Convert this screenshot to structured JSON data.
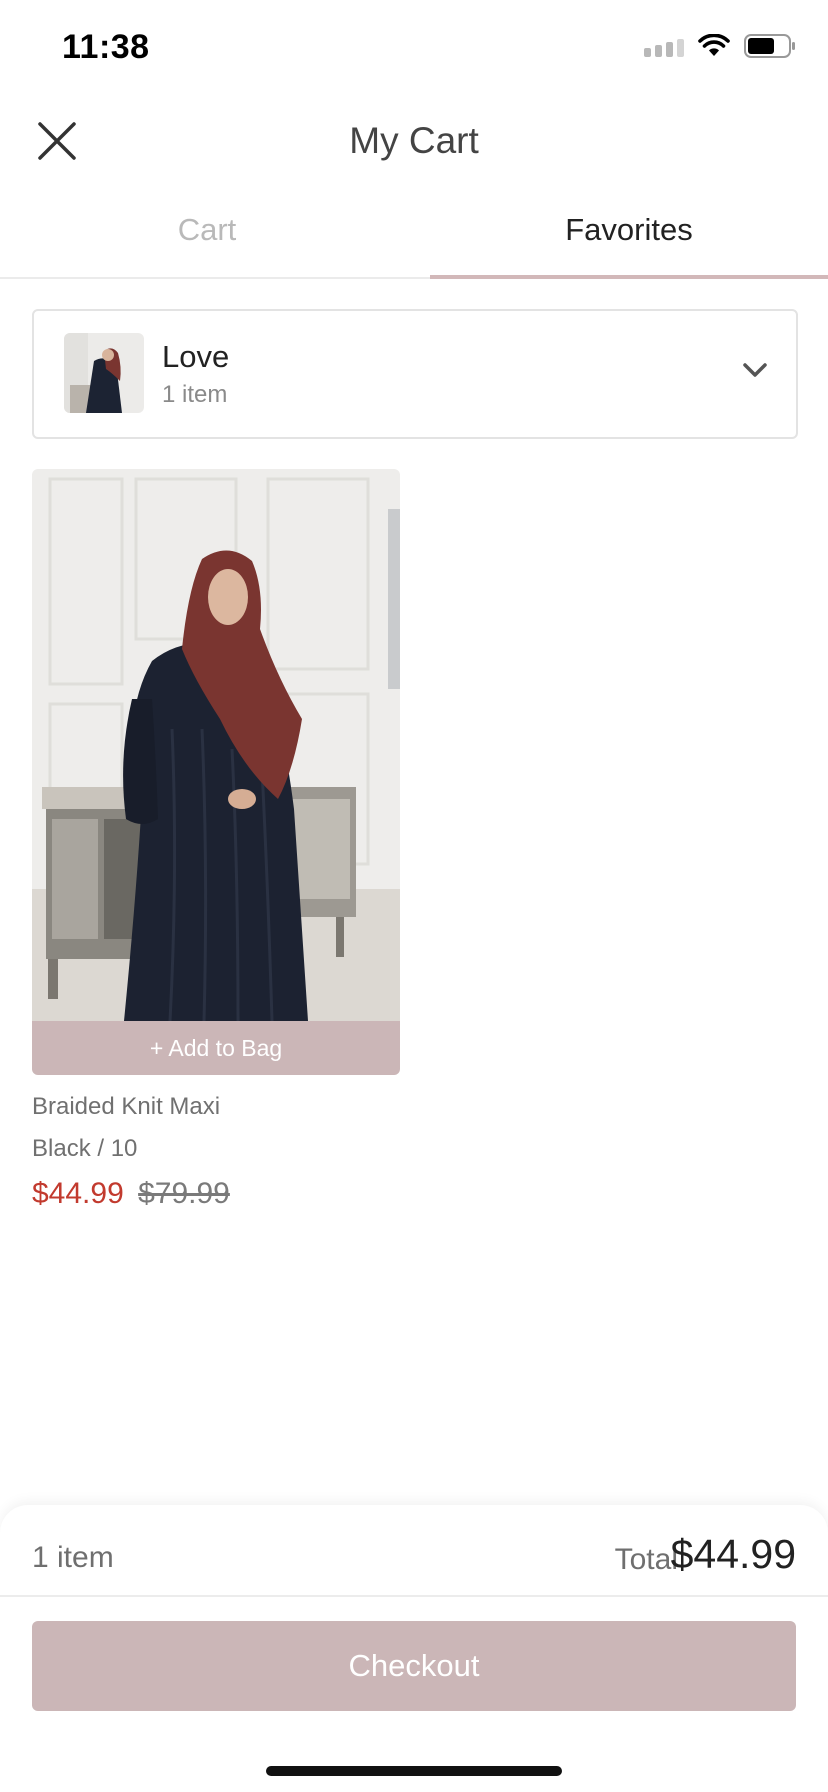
{
  "status_bar": {
    "time": "11:38",
    "icons": [
      "cellular-signal-icon",
      "wifi-icon",
      "battery-icon"
    ]
  },
  "header": {
    "title": "My Cart",
    "close_icon": "close-icon"
  },
  "tabs": [
    {
      "label": "Cart",
      "active": false
    },
    {
      "label": "Favorites",
      "active": true
    }
  ],
  "list_selector": {
    "name": "Love",
    "count": "1 item",
    "chevron_icon": "chevron-down-icon"
  },
  "product": {
    "add_to_bag_label": "+ Add to Bag",
    "name": "Braided Knit Maxi",
    "variant": "Black / 10",
    "sale_price": "$44.99",
    "original_price": "$79.99"
  },
  "summary": {
    "count": "1 item",
    "total_label": "Total",
    "total_value": "$44.99",
    "checkout_label": "Checkout"
  },
  "colors": {
    "accent": "#cbb6b7",
    "sale_price": "#c23a2e",
    "tab_underline": "#d2b8b9"
  }
}
